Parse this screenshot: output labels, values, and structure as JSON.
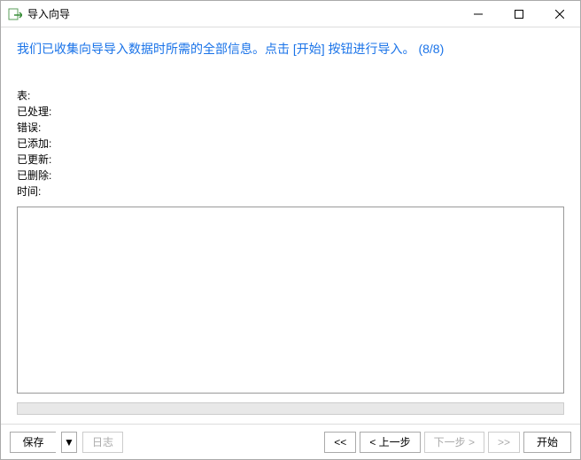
{
  "titlebar": {
    "title": "导入向导"
  },
  "instruction": "我们已收集向导导入数据时所需的全部信息。点击 [开始] 按钮进行导入。 (8/8)",
  "stats": {
    "table": "表",
    "processed": "已处理",
    "errors": "错误",
    "added": "已添加",
    "updated": "已更新",
    "deleted": "已删除",
    "time": "时间"
  },
  "log_text": "",
  "buttons": {
    "save": "保存",
    "log": "日志",
    "first": "<<",
    "prev": "< 上一步",
    "next": "下一步 >",
    "last": ">>",
    "start": "开始"
  }
}
